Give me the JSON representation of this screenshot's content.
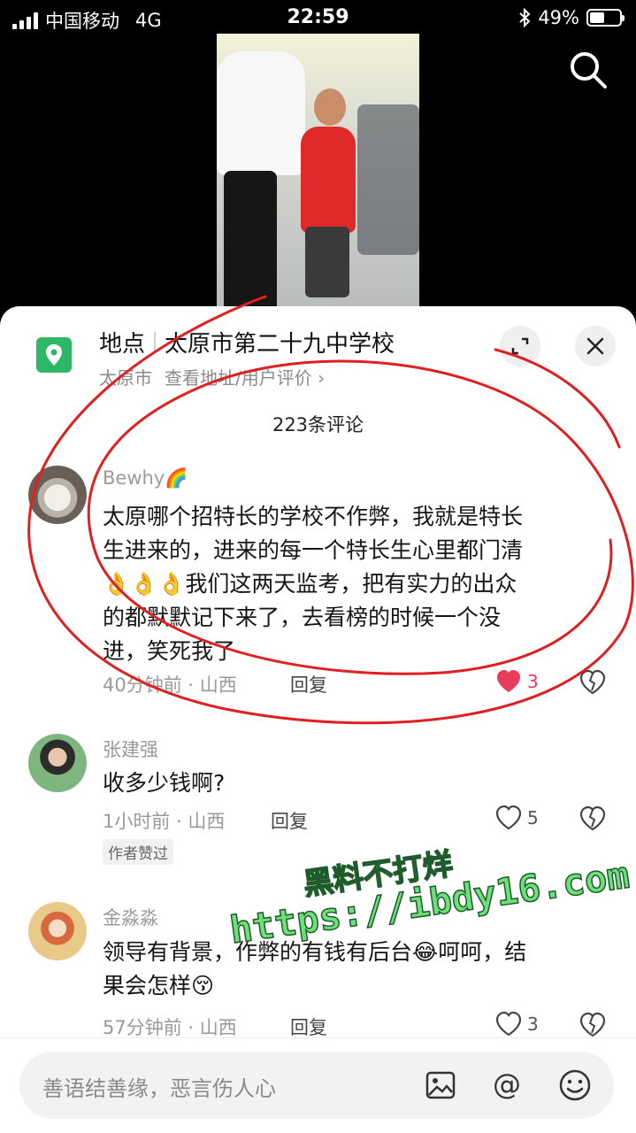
{
  "status_bar": {
    "carrier": "中国移动",
    "network": "4G",
    "time": "22:59",
    "battery_text": "49%",
    "battery_level": 0.49
  },
  "location": {
    "label": "地点",
    "name": "太原市第二十九中学校",
    "city": "太原市",
    "link": "查看地址/用户评价 ›"
  },
  "comments_header": "223条评论",
  "comments": [
    {
      "author": "Bewhy",
      "author_emoji": "🌈",
      "text_lines": [
        "太原哪个招特长的学校不作弊，我就是特长",
        "生进来的，进来的每一个特长生心里都门清",
        "👌👌👌我们这两天监考，把有实力的出众",
        "的都默默记下来了，去看榜的时候一个没",
        "进，笑死我了"
      ],
      "meta": "40分钟前 · 山西",
      "reply": "回复",
      "likes": "3",
      "liked": true
    },
    {
      "author": "张建强",
      "text_lines": [
        "收多少钱啊?"
      ],
      "meta": "1小时前 · 山西",
      "reply": "回复",
      "likes": "5",
      "liked": false,
      "badge": "作者赞过"
    },
    {
      "author": "金淼淼",
      "text_lines": [
        "领导有背景，作弊的有钱有后台😂呵呵，结",
        "果会怎样😚"
      ],
      "meta": "57分钟前 · 山西",
      "reply": "回复",
      "likes": "3",
      "liked": false
    }
  ],
  "watermark": {
    "line1": "黑料不打烊",
    "line2": "https://ibdy16.com"
  },
  "input": {
    "placeholder": "善语结善缘，恶言伤人心"
  },
  "colors": {
    "accent_like": "#ea3b5a",
    "location_icon": "#2fb768",
    "annotation": "#e02020",
    "watermark": "#6ee07a"
  }
}
